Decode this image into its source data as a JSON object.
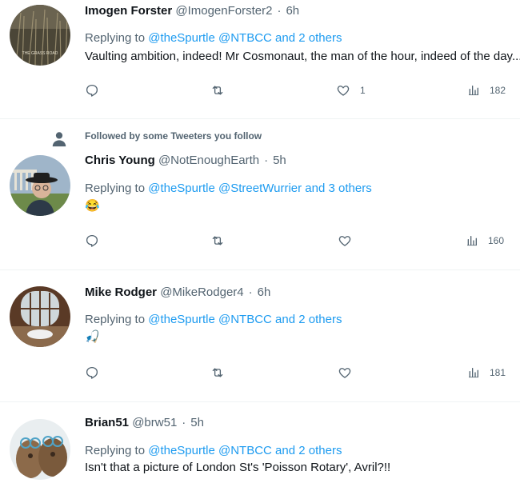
{
  "tweets": [
    {
      "name": "Imogen Forster",
      "handle": "@ImogenForster2",
      "time": "6h",
      "social_context": "",
      "replying_prefix": "Replying to ",
      "replying_users": "@theSpurtle @NTBCC",
      "replying_and": " and ",
      "replying_others": "2 others",
      "text": "Vaulting ambition, indeed! Mr Cosmonaut, the man of the hour, indeed of the day...",
      "avatar_text": "THE GRASS ROAD",
      "reply_count": "",
      "retweet_count": "",
      "like_count": "1",
      "view_count": "182"
    },
    {
      "name": "Chris Young",
      "handle": "@NotEnoughEarth",
      "time": "5h",
      "social_context": "Followed by some Tweeters you follow",
      "replying_prefix": "Replying to ",
      "replying_users": "@theSpurtle @StreetWurrier",
      "replying_and": " and ",
      "replying_others": "3 others",
      "text": "😂",
      "reply_count": "",
      "retweet_count": "",
      "like_count": "",
      "view_count": "160"
    },
    {
      "name": "Mike Rodger",
      "handle": "@MikeRodger4",
      "time": "6h",
      "social_context": "",
      "replying_prefix": "Replying to ",
      "replying_users": "@theSpurtle @NTBCC",
      "replying_and": " and ",
      "replying_others": "2 others",
      "text": "🎣",
      "reply_count": "",
      "retweet_count": "",
      "like_count": "",
      "view_count": "181"
    },
    {
      "name": "Brian51",
      "handle": "@brw51",
      "time": "5h",
      "social_context": "",
      "replying_prefix": "Replying to ",
      "replying_users": "@theSpurtle @NTBCC",
      "replying_and": " and ",
      "replying_others": "2 others",
      "text": "Isn't that a picture of London St's 'Poisson Rotary', Avril?!!"
    }
  ],
  "separator": "·",
  "colors": {
    "link": "#1d9bf0",
    "muted": "#536471",
    "text": "#0f1419",
    "divider": "#eff3f4"
  },
  "icons": [
    "reply-icon",
    "retweet-icon",
    "like-icon",
    "views-icon",
    "person-icon"
  ]
}
